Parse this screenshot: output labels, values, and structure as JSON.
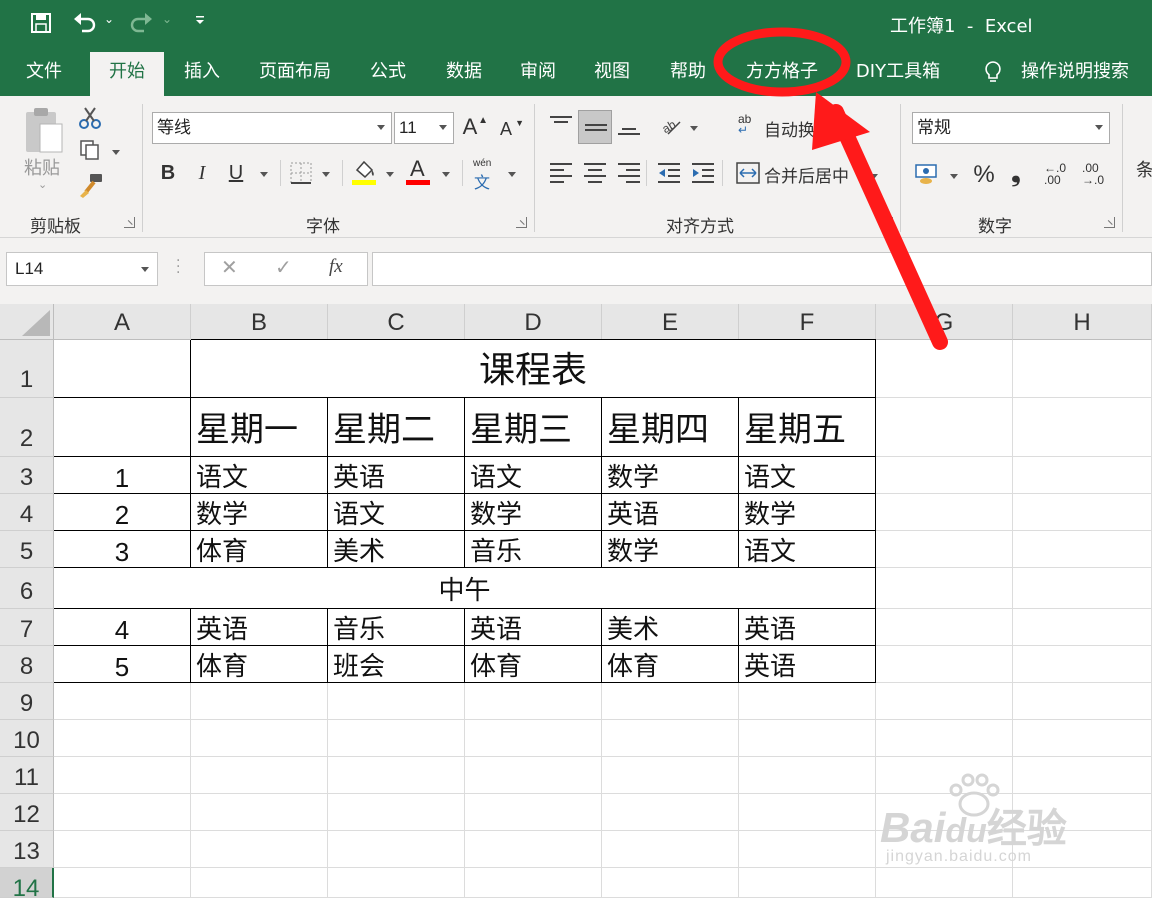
{
  "window": {
    "title": "工作簿1  -  Excel"
  },
  "tabs": [
    {
      "label": "文件"
    },
    {
      "label": "开始"
    },
    {
      "label": "插入"
    },
    {
      "label": "页面布局"
    },
    {
      "label": "公式"
    },
    {
      "label": "数据"
    },
    {
      "label": "审阅"
    },
    {
      "label": "视图"
    },
    {
      "label": "帮助"
    },
    {
      "label": "方方格子"
    },
    {
      "label": "DIY工具箱"
    }
  ],
  "tell_me": {
    "label": "操作说明搜索"
  },
  "ribbon": {
    "clipboard": {
      "paste_label": "粘贴",
      "group_label": "剪贴板"
    },
    "font": {
      "font_name": "等线",
      "font_size": "11",
      "grow": "A",
      "shrink": "A",
      "bold": "B",
      "italic": "I",
      "underline": "U",
      "phonetic_top": "wén",
      "phonetic_bottom": "文",
      "font_color_letter": "A",
      "group_label": "字体",
      "fill_color": "#ffff00",
      "font_color": "#ff0000"
    },
    "alignment": {
      "wrap_label": "自动换行",
      "merge_label": "合并后居中",
      "group_label": "对齐方式",
      "wrap_icon_text": "ab"
    },
    "number": {
      "format": "常规",
      "percent": "%",
      "comma": "❟",
      "inc_decimal_top": "←.0",
      "inc_decimal_bottom": ".00",
      "dec_decimal_top": ".00",
      "dec_decimal_bottom": "→.0",
      "group_label": "数字"
    },
    "styles": {
      "partial_label": "条"
    }
  },
  "formula_bar": {
    "name_box": "L14",
    "cancel": "✕",
    "enter": "✓",
    "fx": "fx",
    "value": ""
  },
  "columns": [
    "A",
    "B",
    "C",
    "D",
    "E",
    "F",
    "G",
    "H"
  ],
  "rows": [
    "1",
    "2",
    "3",
    "4",
    "5",
    "6",
    "7",
    "8",
    "9",
    "10",
    "11",
    "12",
    "13",
    "14"
  ],
  "sheet": {
    "title": "课程表",
    "days": [
      "星期一",
      "星期二",
      "星期三",
      "星期四",
      "星期五"
    ],
    "periods_am": [
      {
        "num": "1",
        "classes": [
          "语文",
          "英语",
          "语文",
          "数学",
          "语文"
        ]
      },
      {
        "num": "2",
        "classes": [
          "数学",
          "语文",
          "数学",
          "英语",
          "数学"
        ]
      },
      {
        "num": "3",
        "classes": [
          "体育",
          "美术",
          "音乐",
          "数学",
          "语文"
        ]
      }
    ],
    "noon": "中午",
    "periods_pm": [
      {
        "num": "4",
        "classes": [
          "英语",
          "音乐",
          "英语",
          "美术",
          "英语"
        ]
      },
      {
        "num": "5",
        "classes": [
          "体育",
          "班会",
          "体育",
          "体育",
          "英语"
        ]
      }
    ]
  },
  "annotation": {
    "color": "#ff1a1a"
  },
  "watermark": {
    "brand": "Bai",
    "brand2": "du",
    "brand_cn": "经验",
    "url": "jingyan.baidu.com"
  },
  "colors": {
    "excel_green": "#217346",
    "ribbon_bg": "#f3f2f1"
  }
}
